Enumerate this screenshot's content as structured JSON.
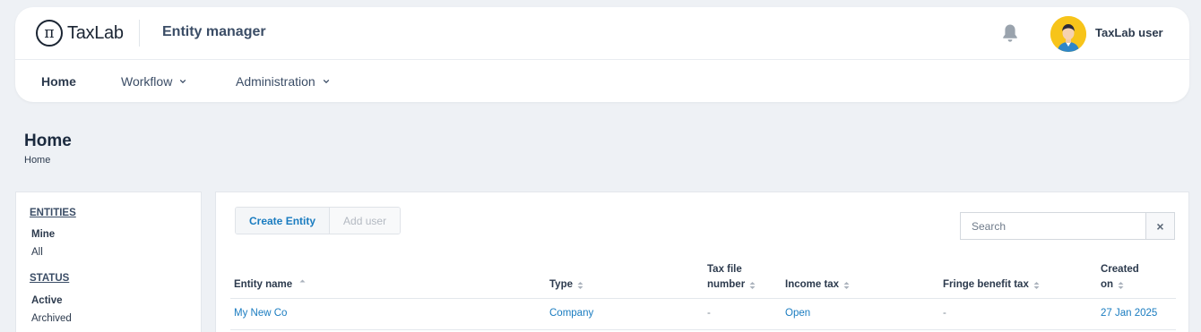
{
  "header": {
    "logo_text": "TaxLab",
    "logo_symbol": "π",
    "app_title": "Entity manager",
    "user_name": "TaxLab user",
    "nav": [
      {
        "label": "Home",
        "active": true
      },
      {
        "label": "Workflow",
        "dropdown": true
      },
      {
        "label": "Administration",
        "dropdown": true
      }
    ]
  },
  "page": {
    "title": "Home",
    "breadcrumb": "Home"
  },
  "sidebar": {
    "entities_heading": "ENTITIES",
    "entities_items": [
      {
        "label": "Mine",
        "selected": true
      },
      {
        "label": "All",
        "selected": false
      }
    ],
    "status_heading": "STATUS",
    "status_items": [
      {
        "label": "Active",
        "selected": true
      },
      {
        "label": "Archived",
        "selected": false
      }
    ]
  },
  "toolbar": {
    "create_label": "Create Entity",
    "add_user_label": "Add user",
    "search_placeholder": "Search",
    "clear_symbol": "×"
  },
  "table": {
    "columns": [
      {
        "line1": "",
        "line2": "Entity name"
      },
      {
        "line1": "",
        "line2": "Type"
      },
      {
        "line1": "Tax file",
        "line2": "number"
      },
      {
        "line1": "",
        "line2": "Income tax"
      },
      {
        "line1": "",
        "line2": "Fringe benefit tax"
      },
      {
        "line1": "Created",
        "line2": "on"
      }
    ],
    "rows": [
      {
        "entity_name": "My New Co",
        "type": "Company",
        "tax_file_number": "-",
        "income_tax": "Open",
        "fringe_benefit_tax": "-",
        "created_on": "27 Jan 2025"
      }
    ]
  },
  "colors": {
    "accent": "#1a7cc0",
    "background": "#eef1f5",
    "avatar_bg": "#f7c41a"
  },
  "icons": {
    "bell": "bell-icon",
    "chevron": "chevron-down-icon",
    "sort": "sort-icon",
    "avatar": "user-avatar"
  }
}
